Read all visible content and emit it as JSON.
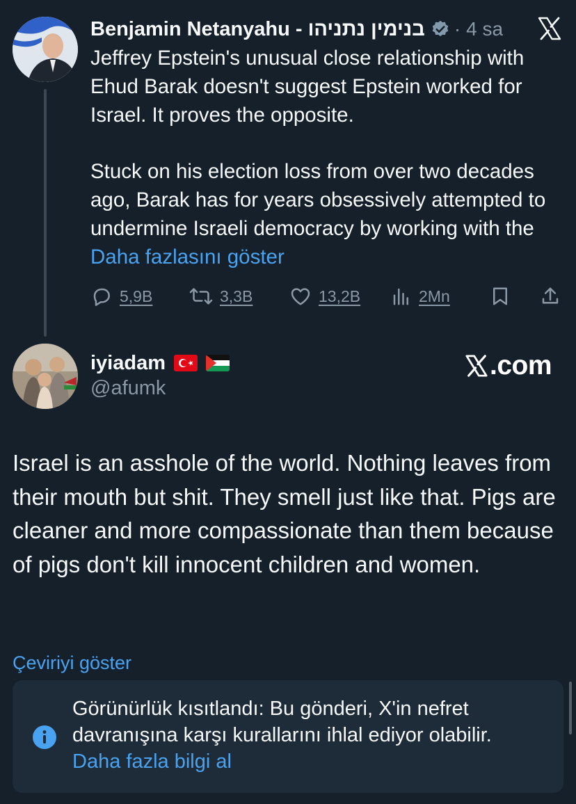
{
  "parent_tweet": {
    "author_name": "Benjamin Netanyahu - בנימין נתניהו",
    "time": "4 sa",
    "separator": "·",
    "paragraph1": "Jeffrey Epstein's unusual close relationship with Ehud Barak doesn't suggest Epstein worked for Israel. It proves the opposite.",
    "paragraph2": "Stuck on his election loss from over two decades ago, Barak has for years obsessively attempted to undermine Israeli democracy by working with the",
    "show_more": "Daha fazlasını göster",
    "replies": "5,9B",
    "reposts": "3,3B",
    "likes": "13,2B",
    "views": "2Mn"
  },
  "reply_tweet": {
    "author_name": "iyiadam",
    "handle": "@afumk",
    "flags": [
      "turkey-flag",
      "palestine-flag"
    ],
    "text": "Israel is an asshole of the world. Nothing leaves from their mouth but shit. They smell just like that. Pigs are cleaner and more compassionate than them because of pigs don't kill innocent children and women.",
    "translate": "Çeviriyi göster"
  },
  "watermark": {
    "suffix": ".com"
  },
  "notice": {
    "text": "Görünürlük kısıtlandı: Bu gönderi, X'in nefret davranışına karşı kurallarını ihlal ediyor olabilir.",
    "link": "Daha fazla bilgi al"
  },
  "colors": {
    "background": "#15202b",
    "text": "#f7f9f9",
    "muted": "#8b98a5",
    "link": "#4aa3f0",
    "notice_bg": "#1e2b39"
  }
}
